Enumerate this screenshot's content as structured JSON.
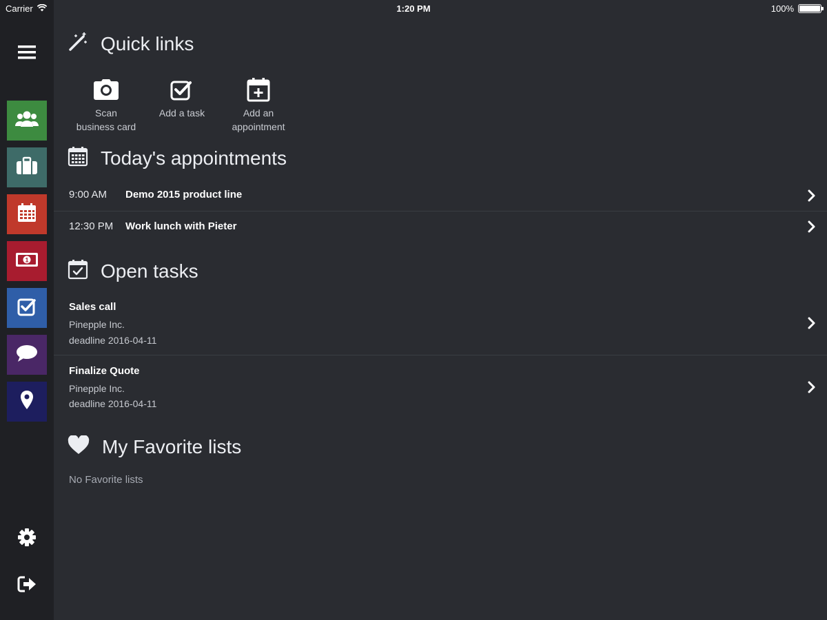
{
  "status_bar": {
    "carrier": "Carrier",
    "time": "1:20 PM",
    "battery": "100%",
    "battery_level": 1.0
  },
  "sidebar": {
    "items": [
      {
        "name": "contacts",
        "icon": "users-icon",
        "color": "#3d8b40"
      },
      {
        "name": "accounts",
        "icon": "briefcase-icon",
        "color": "#3e6b68"
      },
      {
        "name": "calendar",
        "icon": "calendar-icon",
        "color": "#c0392b"
      },
      {
        "name": "opportunities",
        "icon": "money-icon",
        "color": "#a81c2f"
      },
      {
        "name": "tasks",
        "icon": "check-square-icon",
        "color": "#2f5ea8"
      },
      {
        "name": "messages",
        "icon": "chat-bubble-icon",
        "color": "#4a2766"
      },
      {
        "name": "locations",
        "icon": "map-pin-icon",
        "color": "#1d1e5e"
      }
    ],
    "bottom": [
      {
        "name": "settings",
        "icon": "gear-icon"
      },
      {
        "name": "logout",
        "icon": "sign-out-icon"
      }
    ]
  },
  "quick_links": {
    "title": "Quick links",
    "items": [
      {
        "line1": "Scan",
        "line2": "business card",
        "icon": "camera-icon"
      },
      {
        "line1": "Add a task",
        "line2": "",
        "icon": "check-square-icon"
      },
      {
        "line1": "Add an",
        "line2": "appointment",
        "icon": "calendar-plus-icon"
      }
    ]
  },
  "appointments": {
    "title": "Today's appointments",
    "items": [
      {
        "time": "9:00 AM",
        "title": "Demo 2015 product line"
      },
      {
        "time": "12:30 PM",
        "title": "Work lunch with Pieter"
      }
    ]
  },
  "tasks": {
    "title": "Open tasks",
    "items": [
      {
        "title": "Sales call",
        "company": "Pinepple Inc.",
        "deadline": "deadline 2016-04-11"
      },
      {
        "title": "Finalize Quote",
        "company": "Pinepple Inc.",
        "deadline": "deadline 2016-04-11"
      }
    ]
  },
  "favorites": {
    "title": "My Favorite lists",
    "empty": "No Favorite lists"
  }
}
